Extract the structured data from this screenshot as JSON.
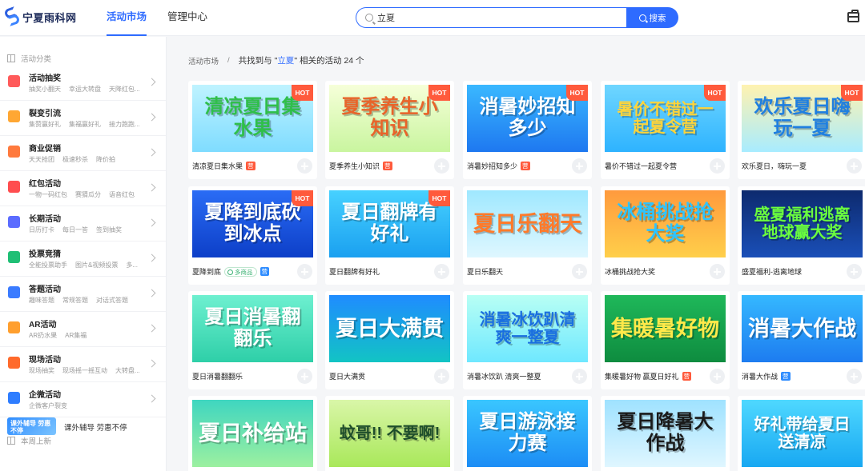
{
  "app": {
    "logo_text": "宁夏雨科网"
  },
  "nav": {
    "items": [
      "活动市场",
      "管理中心"
    ],
    "active": 0
  },
  "search": {
    "value": "立夏",
    "button_label": "搜索"
  },
  "sidebar": {
    "categories_heading": "活动分类",
    "categories": [
      {
        "title": "活动抽奖",
        "subs": [
          "抽奖小翻天",
          "幸运大转盘",
          "天降红包..."
        ],
        "color": "#ff5a5a",
        "icon": "gift-icon"
      },
      {
        "title": "裂变引流",
        "subs": [
          "集赞赢好礼",
          "集福赢好礼",
          "接力跑跑..."
        ],
        "color": "#ffa733",
        "icon": "user-icon"
      },
      {
        "title": "商业促销",
        "subs": [
          "天天抢团",
          "极速秒杀",
          "降价拍"
        ],
        "color": "#ff7a3d",
        "icon": "tag-icon"
      },
      {
        "title": "红包活动",
        "subs": [
          "一物一码红包",
          "赛猜瓜分",
          "语音红包"
        ],
        "color": "#ff4d4f",
        "icon": "red-envelope-icon"
      },
      {
        "title": "长期活动",
        "subs": [
          "日历打卡",
          "每日一答",
          "签到抽奖"
        ],
        "color": "#5b6cff",
        "icon": "calendar-icon"
      },
      {
        "title": "投票竞猜",
        "subs": [
          "全能投票助手",
          "图片&视频投票",
          "多..."
        ],
        "color": "#1fbf75",
        "icon": "vote-icon"
      },
      {
        "title": "答题活动",
        "subs": [
          "趣味答题",
          "常规答题",
          "对话式答题"
        ],
        "color": "#3a7bff",
        "icon": "question-icon"
      },
      {
        "title": "AR活动",
        "subs": [
          "AR扔水果",
          "AR集福"
        ],
        "color": "#ff9f2e",
        "icon": "robot-icon"
      },
      {
        "title": "现场活动",
        "subs": [
          "现场抽奖",
          "现场摇一摇互动",
          "大转盘..."
        ],
        "color": "#ff6a2b",
        "icon": "scene-icon"
      },
      {
        "title": "企微活动",
        "subs": [
          "企微客户裂变"
        ],
        "color": "#2e7dff",
        "icon": "wecom-icon"
      }
    ],
    "new_heading": "本周上新",
    "new_item": {
      "thumb_text": "课外辅导 劳惠不停",
      "label": "课外辅导 劳惠不停"
    }
  },
  "breadcrumb": {
    "root": "活动市场",
    "separator": "/",
    "result_prefix": "共找到与 \"",
    "keyword": "立夏",
    "result_suffix": "\" 相关的活动 24 个"
  },
  "hot_label": "HOT",
  "cards": [
    {
      "title": "清凉夏日集水果",
      "badge": "营",
      "badge_type": "red",
      "hot": true,
      "thumb_text": "清凉夏日集水果",
      "bg": "linear-gradient(180deg,#bff3ff,#7fdcff)",
      "fg": "#2fbf4a"
    },
    {
      "title": "夏季养生小知识",
      "badge": "营",
      "badge_type": "red",
      "hot": true,
      "thumb_text": "夏季养生小知识",
      "bg": "linear-gradient(180deg,#f6ffd9,#c9f59f)",
      "fg": "#e8642a"
    },
    {
      "title": "消暑妙招知多少",
      "badge": "营",
      "badge_type": "red",
      "hot": true,
      "thumb_text": "消暑妙招知多少",
      "bg": "linear-gradient(180deg,#3ab8ff,#1e78f0)",
      "fg": "#ffffff"
    },
    {
      "title": "暑价不错过一起夏令营",
      "badge": "",
      "badge_type": "",
      "hot": true,
      "thumb_text": "暑价不错过一起夏令营",
      "bg": "linear-gradient(180deg,#6fd6ff,#2eb3ff)",
      "fg": "#ffd43a"
    },
    {
      "title": "欢乐夏日，嗨玩一夏",
      "badge": "",
      "badge_type": "",
      "hot": true,
      "thumb_text": "欢乐夏日嗨玩一夏",
      "bg": "linear-gradient(180deg,#fff2b0,#a8ecff)",
      "fg": "#1f7fe0"
    },
    {
      "title": "夏降到底",
      "badge": "多商品",
      "badge_type": "outline",
      "badge2": "营",
      "hot": true,
      "thumb_text": "夏降到底砍到冰点",
      "bg": "linear-gradient(180deg,#2a6cf5,#0d3fc8)",
      "fg": "#ffffff"
    },
    {
      "title": "夏日翻牌有好礼",
      "badge": "",
      "badge_type": "",
      "hot": true,
      "thumb_text": "夏日翻牌有好礼",
      "bg": "linear-gradient(180deg,#47d1ff,#1aa0f0)",
      "fg": "#ffffff"
    },
    {
      "title": "夏日乐翻天",
      "badge": "",
      "badge_type": "",
      "hot": false,
      "thumb_text": "夏日乐翻天",
      "bg": "linear-gradient(180deg,#9fe8ff,#dff7ff)",
      "fg": "#ff7a2a"
    },
    {
      "title": "冰桶挑战抢大奖",
      "badge": "",
      "badge_type": "",
      "hot": false,
      "thumb_text": "冰桶挑战抢大奖",
      "bg": "linear-gradient(180deg,#ff9a3d,#ffcf4a)",
      "fg": "#2ec4ff"
    },
    {
      "title": "盛夏福利-逃离地球",
      "badge": "",
      "badge_type": "",
      "hot": false,
      "thumb_text": "盛夏福利逃离地球赢大奖",
      "bg": "linear-gradient(180deg,#0d2a6e,#1a4fb8)",
      "fg": "#6bff3e"
    },
    {
      "title": "夏日消暑翻翻乐",
      "badge": "",
      "badge_type": "",
      "hot": false,
      "thumb_text": "夏日消暑翻翻乐",
      "bg": "linear-gradient(180deg,#6ef0d0,#2ecfa8)",
      "fg": "#ffffff"
    },
    {
      "title": "夏日大满贯",
      "badge": "",
      "badge_type": "",
      "hot": false,
      "thumb_text": "夏日大满贯",
      "bg": "linear-gradient(180deg,#1f8cff,#12c4c4)",
      "fg": "#ffffff"
    },
    {
      "title": "消暑冰饮趴 清爽一整夏",
      "badge": "",
      "badge_type": "",
      "hot": false,
      "thumb_text": "消暑冰饮趴清爽一整夏",
      "bg": "linear-gradient(180deg,#b8fff4,#6fe8ff)",
      "fg": "#1a6fe0"
    },
    {
      "title": "集暖暑好物 赢夏日好礼",
      "badge": "营",
      "badge_type": "red",
      "hot": false,
      "thumb_text": "集暖暑好物",
      "bg": "linear-gradient(180deg,#1fb85a,#0e8c3f)",
      "fg": "#ffe94a"
    },
    {
      "title": "消暑大作战",
      "badge": "营",
      "badge_type": "blue",
      "hot": false,
      "thumb_text": "消暑大作战",
      "bg": "linear-gradient(180deg,#35b8ff,#1d7cf0)",
      "fg": "#ffffff"
    },
    {
      "title": "",
      "badge": "",
      "badge_type": "",
      "hot": false,
      "thumb_text": "夏日补给站",
      "bg": "linear-gradient(180deg,#3fd6c0,#9cf0a0)",
      "fg": "#ffffff"
    },
    {
      "title": "",
      "badge": "",
      "badge_type": "",
      "hot": false,
      "thumb_text": "蚊哥!! 不要啊!",
      "bg": "linear-gradient(180deg,#d9f6a8,#a9e85a)",
      "fg": "#1e4d2b"
    },
    {
      "title": "",
      "badge": "",
      "badge_type": "",
      "hot": false,
      "thumb_text": "夏日游泳接力赛",
      "bg": "linear-gradient(180deg,#3ac6ff,#1c8df5)",
      "fg": "#ffffff"
    },
    {
      "title": "",
      "badge": "",
      "badge_type": "",
      "hot": false,
      "thumb_text": "夏日降暑大作战",
      "bg": "linear-gradient(180deg,#9fe2ff,#dff6ff)",
      "fg": "#1a1a1a"
    },
    {
      "title": "",
      "badge": "",
      "badge_type": "",
      "hot": false,
      "thumb_text": "好礼带给夏日送清凉",
      "bg": "linear-gradient(180deg,#4fd8ff,#18a8f2)",
      "fg": "#ffffff"
    }
  ]
}
